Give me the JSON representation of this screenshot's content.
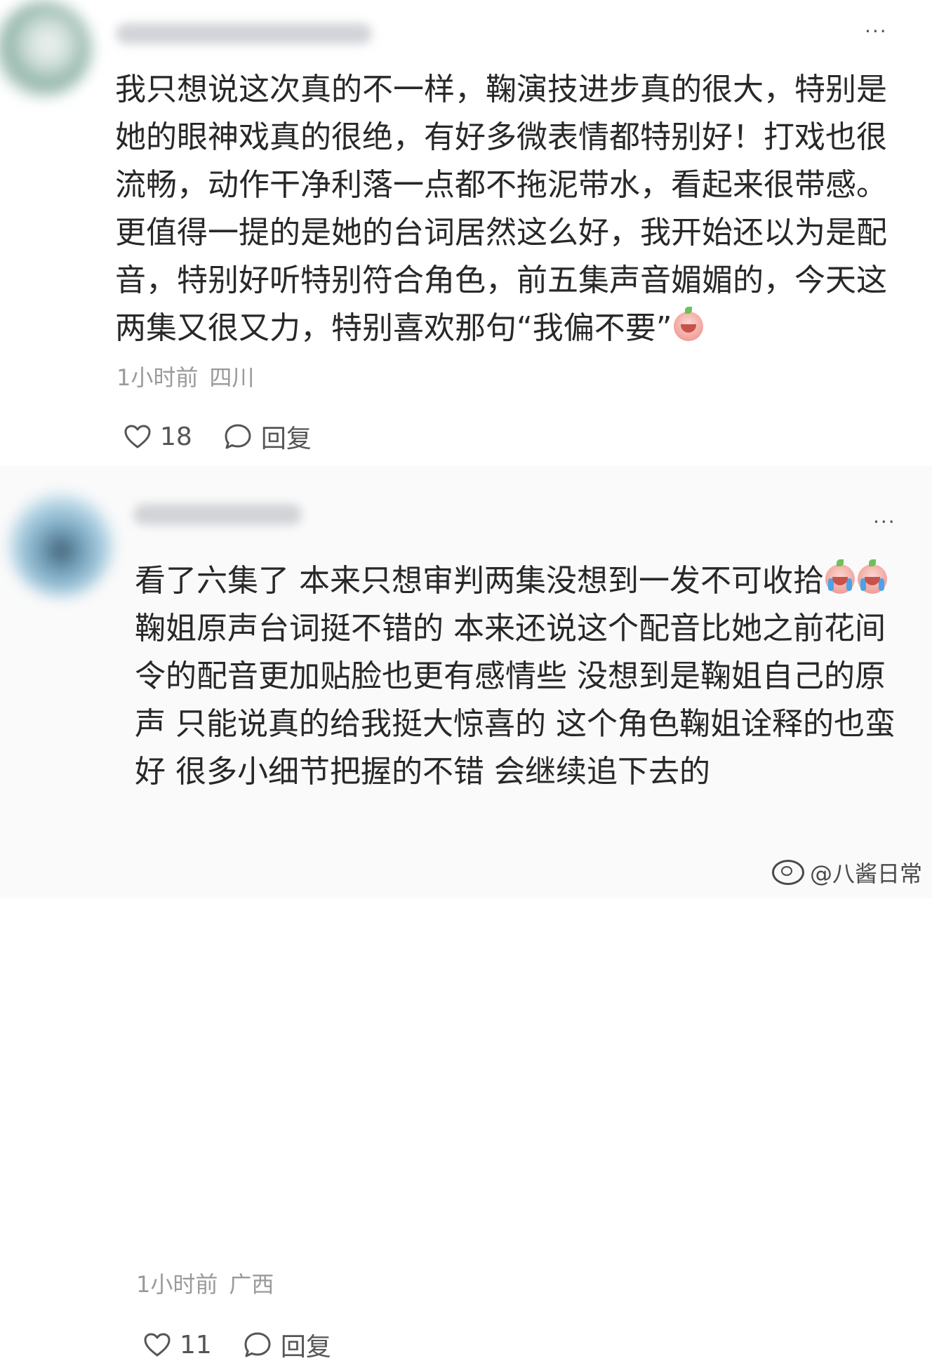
{
  "comments": [
    {
      "more_icon": "more-horizontal-icon",
      "text_before_emoji": "我只想说这次真的不一样，鞠演技进步真的很大，特别是她的眼神戏真的很绝，有好多微表情都特别好！打戏也很流畅，动作干净利落一点都不拖泥带水，看起来很带感。更值得一提的是她的台词居然这么好，我开始还以为是配音，特别好听特别符合角色，前五集声音媚媚的，今天这两集又很又力，特别喜欢那句“我偏不要”",
      "emoji": "shy-face-emoji",
      "time": "1小时前",
      "location": "四川",
      "likes": "18",
      "reply_label": "回复",
      "like_icon": "heart-icon",
      "reply_icon": "comment-bubble-icon"
    },
    {
      "more_icon": "more-horizontal-icon",
      "text_part1": "看了六集了 本来只想审判两集没想到一发不可收拾",
      "text_part2": "鞠姐原声台词挺不错的 本来还说这个配音比她之前花间令的配音更加贴脸也更有感情些 没想到是鞠姐自己的原声 只能说真的给我挺大惊喜的 这个角色鞠姐诠释的也蛮好 很多小细节把握的不错 会继续追下去的",
      "emoji": "crying-face-emoji",
      "time": "1小时前",
      "location": "广西",
      "likes": "11",
      "reply_label": "回复",
      "like_icon": "heart-icon",
      "reply_icon": "comment-bubble-icon"
    }
  ],
  "watermark": "@八酱日常",
  "watermark_icon": "weibo-logo-icon"
}
